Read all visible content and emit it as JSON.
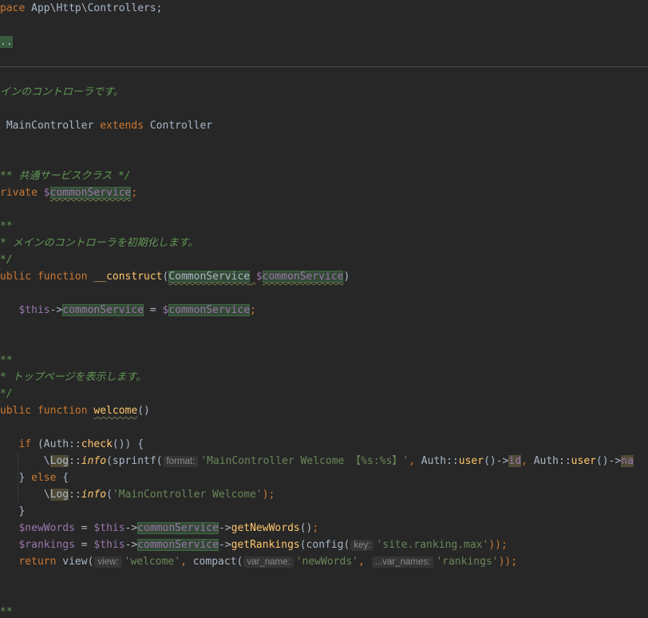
{
  "theme": {
    "background": "#272727",
    "keyword": "#cc7832",
    "string": "#6a8759",
    "variable": "#9876aa",
    "function": "#ffc66d",
    "doc_comment": "#629755",
    "text": "#a9b7c6"
  },
  "lines": [
    {
      "n": 0,
      "tokens": [
        [
          "pace",
          "k"
        ],
        [
          " App\\Http\\Controllers;",
          "p"
        ]
      ]
    },
    {
      "n": 2,
      "tokens": [
        [
          "..",
          "fold"
        ]
      ]
    },
    {
      "n": 5,
      "tokens": [
        [
          "インのコントローラです。",
          "c"
        ]
      ]
    },
    {
      "n": 7,
      "tokens": [
        [
          " MainController ",
          "p"
        ],
        [
          "extends",
          "k"
        ],
        [
          " Controller",
          "p"
        ]
      ]
    },
    {
      "n": 10,
      "tokens": [
        [
          "** 共通サービスクラス */",
          "c"
        ]
      ]
    },
    {
      "n": 11,
      "tokens": [
        [
          "rivate ",
          "k"
        ],
        [
          "$",
          "v"
        ],
        [
          "commonService",
          "v hl w"
        ],
        [
          ";",
          "k"
        ]
      ]
    },
    {
      "n": 13,
      "tokens": [
        [
          "**",
          "c"
        ]
      ]
    },
    {
      "n": 14,
      "tokens": [
        [
          "* メインのコントローラを初期化します。",
          "c"
        ]
      ]
    },
    {
      "n": 15,
      "tokens": [
        [
          "*/",
          "c"
        ]
      ]
    },
    {
      "n": 16,
      "tokens": [
        [
          "ublic function ",
          "k"
        ],
        [
          "__construct",
          "f"
        ],
        [
          "(",
          "p"
        ],
        [
          "CommonService",
          "p hl w"
        ],
        [
          " ",
          "p w"
        ],
        [
          "$",
          "v"
        ],
        [
          "commonService",
          "v hl w"
        ],
        [
          ")",
          "p"
        ]
      ]
    },
    {
      "n": 18,
      "tokens": [
        [
          "   ",
          "p"
        ],
        [
          "$this",
          "v"
        ],
        [
          "->",
          "p"
        ],
        [
          "commonService",
          "v hl"
        ],
        [
          " = ",
          "p"
        ],
        [
          "$",
          "v"
        ],
        [
          "commonService",
          "v hl"
        ],
        [
          ";",
          "k"
        ]
      ]
    },
    {
      "n": 21,
      "tokens": [
        [
          "**",
          "c"
        ]
      ]
    },
    {
      "n": 22,
      "tokens": [
        [
          "* トップページを表示します。",
          "c"
        ]
      ]
    },
    {
      "n": 23,
      "tokens": [
        [
          "*/",
          "c"
        ]
      ]
    },
    {
      "n": 24,
      "tokens": [
        [
          "ublic function ",
          "k"
        ],
        [
          "welcome",
          "f w"
        ],
        [
          "()",
          "p"
        ]
      ]
    },
    {
      "n": 26,
      "tokens": [
        [
          "   ",
          "p"
        ],
        [
          "if",
          "k"
        ],
        [
          " (Auth::",
          "p"
        ],
        [
          "check",
          "f"
        ],
        [
          "()) {",
          "p"
        ]
      ]
    },
    {
      "n": 27,
      "tokens": [
        [
          "       \\",
          "p"
        ],
        [
          "Log",
          "p lb"
        ],
        [
          "::",
          "p"
        ],
        [
          "info",
          "fi"
        ],
        [
          "(sprintf(",
          "p"
        ],
        [
          "format:",
          "h"
        ],
        [
          "'MainController Welcome 【%s:%s】'",
          "s"
        ],
        [
          ", ",
          "k"
        ],
        [
          "Auth::",
          "p"
        ],
        [
          "user",
          "f"
        ],
        [
          "()->",
          "p"
        ],
        [
          "id",
          "v lb"
        ],
        [
          ", ",
          "k"
        ],
        [
          "Auth::",
          "p"
        ],
        [
          "user",
          "f"
        ],
        [
          "()->",
          "p"
        ],
        [
          "na",
          "v lb"
        ]
      ]
    },
    {
      "n": 28,
      "tokens": [
        [
          "   } ",
          "p"
        ],
        [
          "else",
          "k"
        ],
        [
          " {",
          "p"
        ]
      ]
    },
    {
      "n": 29,
      "tokens": [
        [
          "       \\",
          "p"
        ],
        [
          "Log",
          "p lb"
        ],
        [
          "::",
          "p"
        ],
        [
          "info",
          "fi"
        ],
        [
          "(",
          "p"
        ],
        [
          "'MainController Welcome'",
          "s"
        ],
        [
          ");",
          "k"
        ]
      ]
    },
    {
      "n": 30,
      "tokens": [
        [
          "   }",
          "p"
        ]
      ]
    },
    {
      "n": 31,
      "tokens": [
        [
          "   ",
          "p"
        ],
        [
          "$newWords",
          "v"
        ],
        [
          " = ",
          "p"
        ],
        [
          "$this",
          "v"
        ],
        [
          "->",
          "p"
        ],
        [
          "commonService",
          "v hl"
        ],
        [
          "->",
          "p"
        ],
        [
          "getNewWords",
          "f"
        ],
        [
          "()",
          "p"
        ],
        [
          ";",
          "k"
        ]
      ]
    },
    {
      "n": 32,
      "tokens": [
        [
          "   ",
          "p"
        ],
        [
          "$rankings",
          "v"
        ],
        [
          " = ",
          "p"
        ],
        [
          "$this",
          "v"
        ],
        [
          "->",
          "p"
        ],
        [
          "commonService",
          "v hl"
        ],
        [
          "->",
          "p"
        ],
        [
          "getRankings",
          "f"
        ],
        [
          "(config(",
          "p"
        ],
        [
          "key:",
          "h"
        ],
        [
          "'site.ranking.max'",
          "s"
        ],
        [
          "));",
          "k"
        ]
      ]
    },
    {
      "n": 33,
      "tokens": [
        [
          "   ",
          "p"
        ],
        [
          "return",
          "k"
        ],
        [
          " view(",
          "p"
        ],
        [
          "view:",
          "h"
        ],
        [
          "'welcome'",
          "s"
        ],
        [
          ", ",
          "k"
        ],
        [
          "compact(",
          "p"
        ],
        [
          "var_name:",
          "h"
        ],
        [
          "'newWords'",
          "s"
        ],
        [
          ", ",
          "k"
        ],
        [
          "...var_names:",
          "h"
        ],
        [
          "'rankings'",
          "s"
        ],
        [
          "));",
          "k"
        ]
      ]
    },
    {
      "n": 36,
      "tokens": [
        [
          "**",
          "c"
        ]
      ]
    }
  ]
}
